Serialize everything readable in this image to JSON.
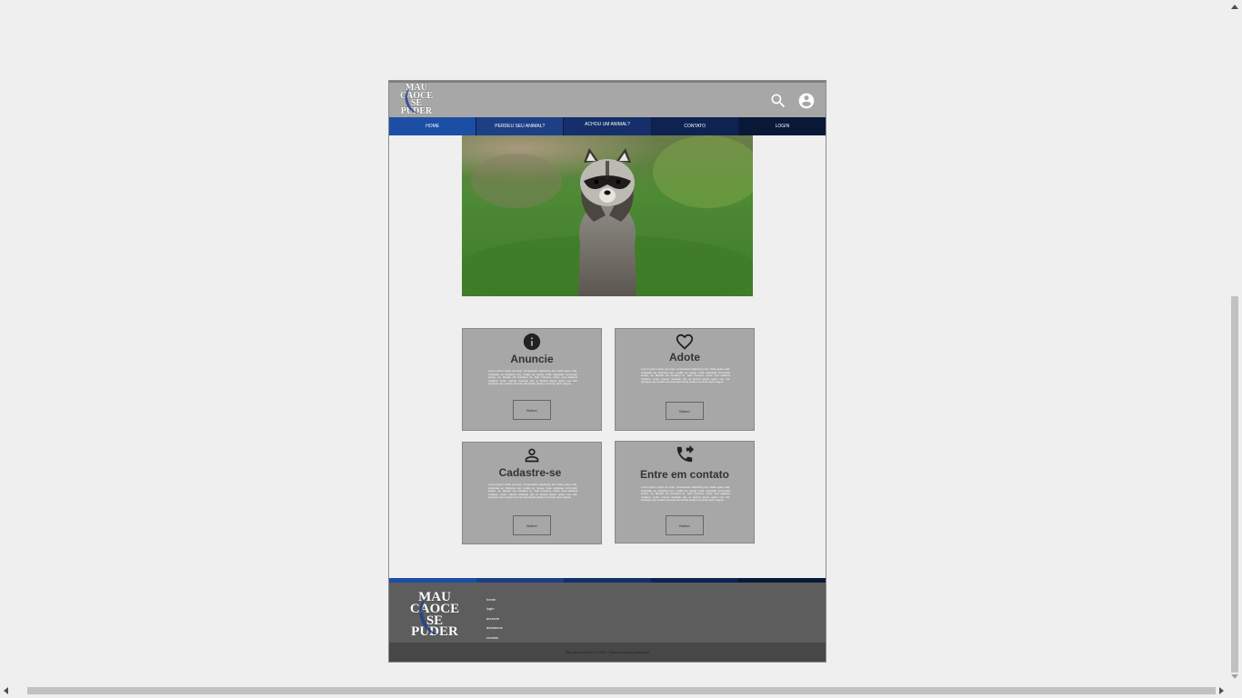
{
  "header": {
    "logo_lines": [
      "MAU",
      "CAOCE",
      "SE",
      "PUDER"
    ],
    "search_icon": "search-icon",
    "account_icon": "account-circle-icon"
  },
  "nav": {
    "items": [
      "HOME",
      "PERDEU SEU ANIMAL?",
      "ACHOU UM ANIMAL?",
      "CONTATO",
      "LOGIN"
    ]
  },
  "hero": {
    "image": "raccoon-photo"
  },
  "cards": [
    {
      "title": "Anuncie",
      "icon": "info-icon",
      "text": "Lorem ipsum dolor sit amet, consectetur adipiscing elit. Nulla quam velit, vulputate eu pharetra nec, mattis ac neque. Duis vulputate commodo lectus, ac blandit elit tincidunt id. Sed rhoncus, tortor sed eleifend tristique, tortor mauris molestie elit, et lacinia ipsum quam nec dui. Quisque nec mauris sit amet elit iaculis pretium sit amet quis magna.",
      "button": "Button"
    },
    {
      "title": "Adote",
      "icon": "heart-icon",
      "text": "Lorem ipsum dolor sit amet, consectetur adipiscing elit. Nulla quam velit, vulputate eu pharetra nec, mattis ac neque. Duis vulputate commodo lectus, ac blandit elit tincidunt id. Sed rhoncus, tortor sed eleifend tristique, tortor mauris molestie elit, et lacinia ipsum quam nec dui. Quisque nec mauris sit amet elit iaculis pretium sit amet quis magna.",
      "button": "Button"
    },
    {
      "title": "Cadastre-se",
      "icon": "person-icon",
      "text": "Lorem ipsum dolor sit amet, consectetur adipiscing elit. Nulla quam velit, vulputate eu pharetra nec, mattis ac neque. Duis vulputate commodo lectus, ac blandit elit tincidunt id. Sed rhoncus, tortor sed eleifend tristique, tortor mauris molestie elit, et lacinia ipsum quam nec dui. Quisque nec mauris sit amet elit iaculis pretium sit amet quis magna.",
      "button": "Button"
    },
    {
      "title": "Entre em contato",
      "icon": "phone-forwarded-icon",
      "text": "Lorem ipsum dolor sit amet, consectetur adipiscing elit. Nulla quam velit, vulputate eu pharetra nec, mattis ac neque. Duis vulputate commodo lectus, ac blandit elit tincidunt id. Sed rhoncus, tortor sed eleifend tristique, tortor mauris molestie elit, et lacinia ipsum quam nec dui. Quisque nec mauris sit amet elit iaculis pretium sit amet quis magna.",
      "button": "Button"
    }
  ],
  "footer": {
    "logo_lines": [
      "MAU",
      "CAOCE",
      "SE",
      "PUDER"
    ],
    "links": [
      "home",
      "login",
      "anuncie",
      "adotamos",
      "contato"
    ],
    "copyright": "Mau caoce se Puder © 2020 - Todos os direitos reservados"
  },
  "colors": {
    "nav_1": "#1c4ea6",
    "nav_2": "#1d3f86",
    "nav_3": "#142f6a",
    "nav_4": "#0e2352",
    "nav_5": "#0a1838",
    "header_bg": "#a7a7a7",
    "footer_bg": "#5d5d5d"
  }
}
